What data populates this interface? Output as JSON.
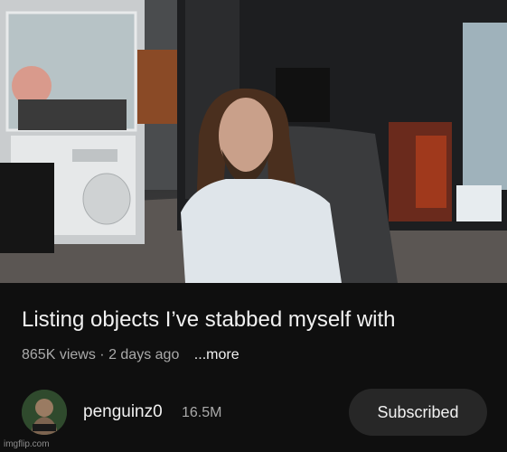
{
  "video": {
    "title": "Listing objects I’ve stabbed myself with",
    "views": "865K views",
    "separator": "·",
    "age": "2 days ago",
    "more_label": "...more"
  },
  "channel": {
    "name": "penguinz0",
    "subscribers": "16.5M",
    "subscribe_label": "Subscribed"
  },
  "watermark": "imgflip.com",
  "colors": {
    "background": "#0f0f0f",
    "primary_text": "#f1f1f1",
    "secondary_text": "#aaaaaa",
    "button_bg": "#272727"
  }
}
